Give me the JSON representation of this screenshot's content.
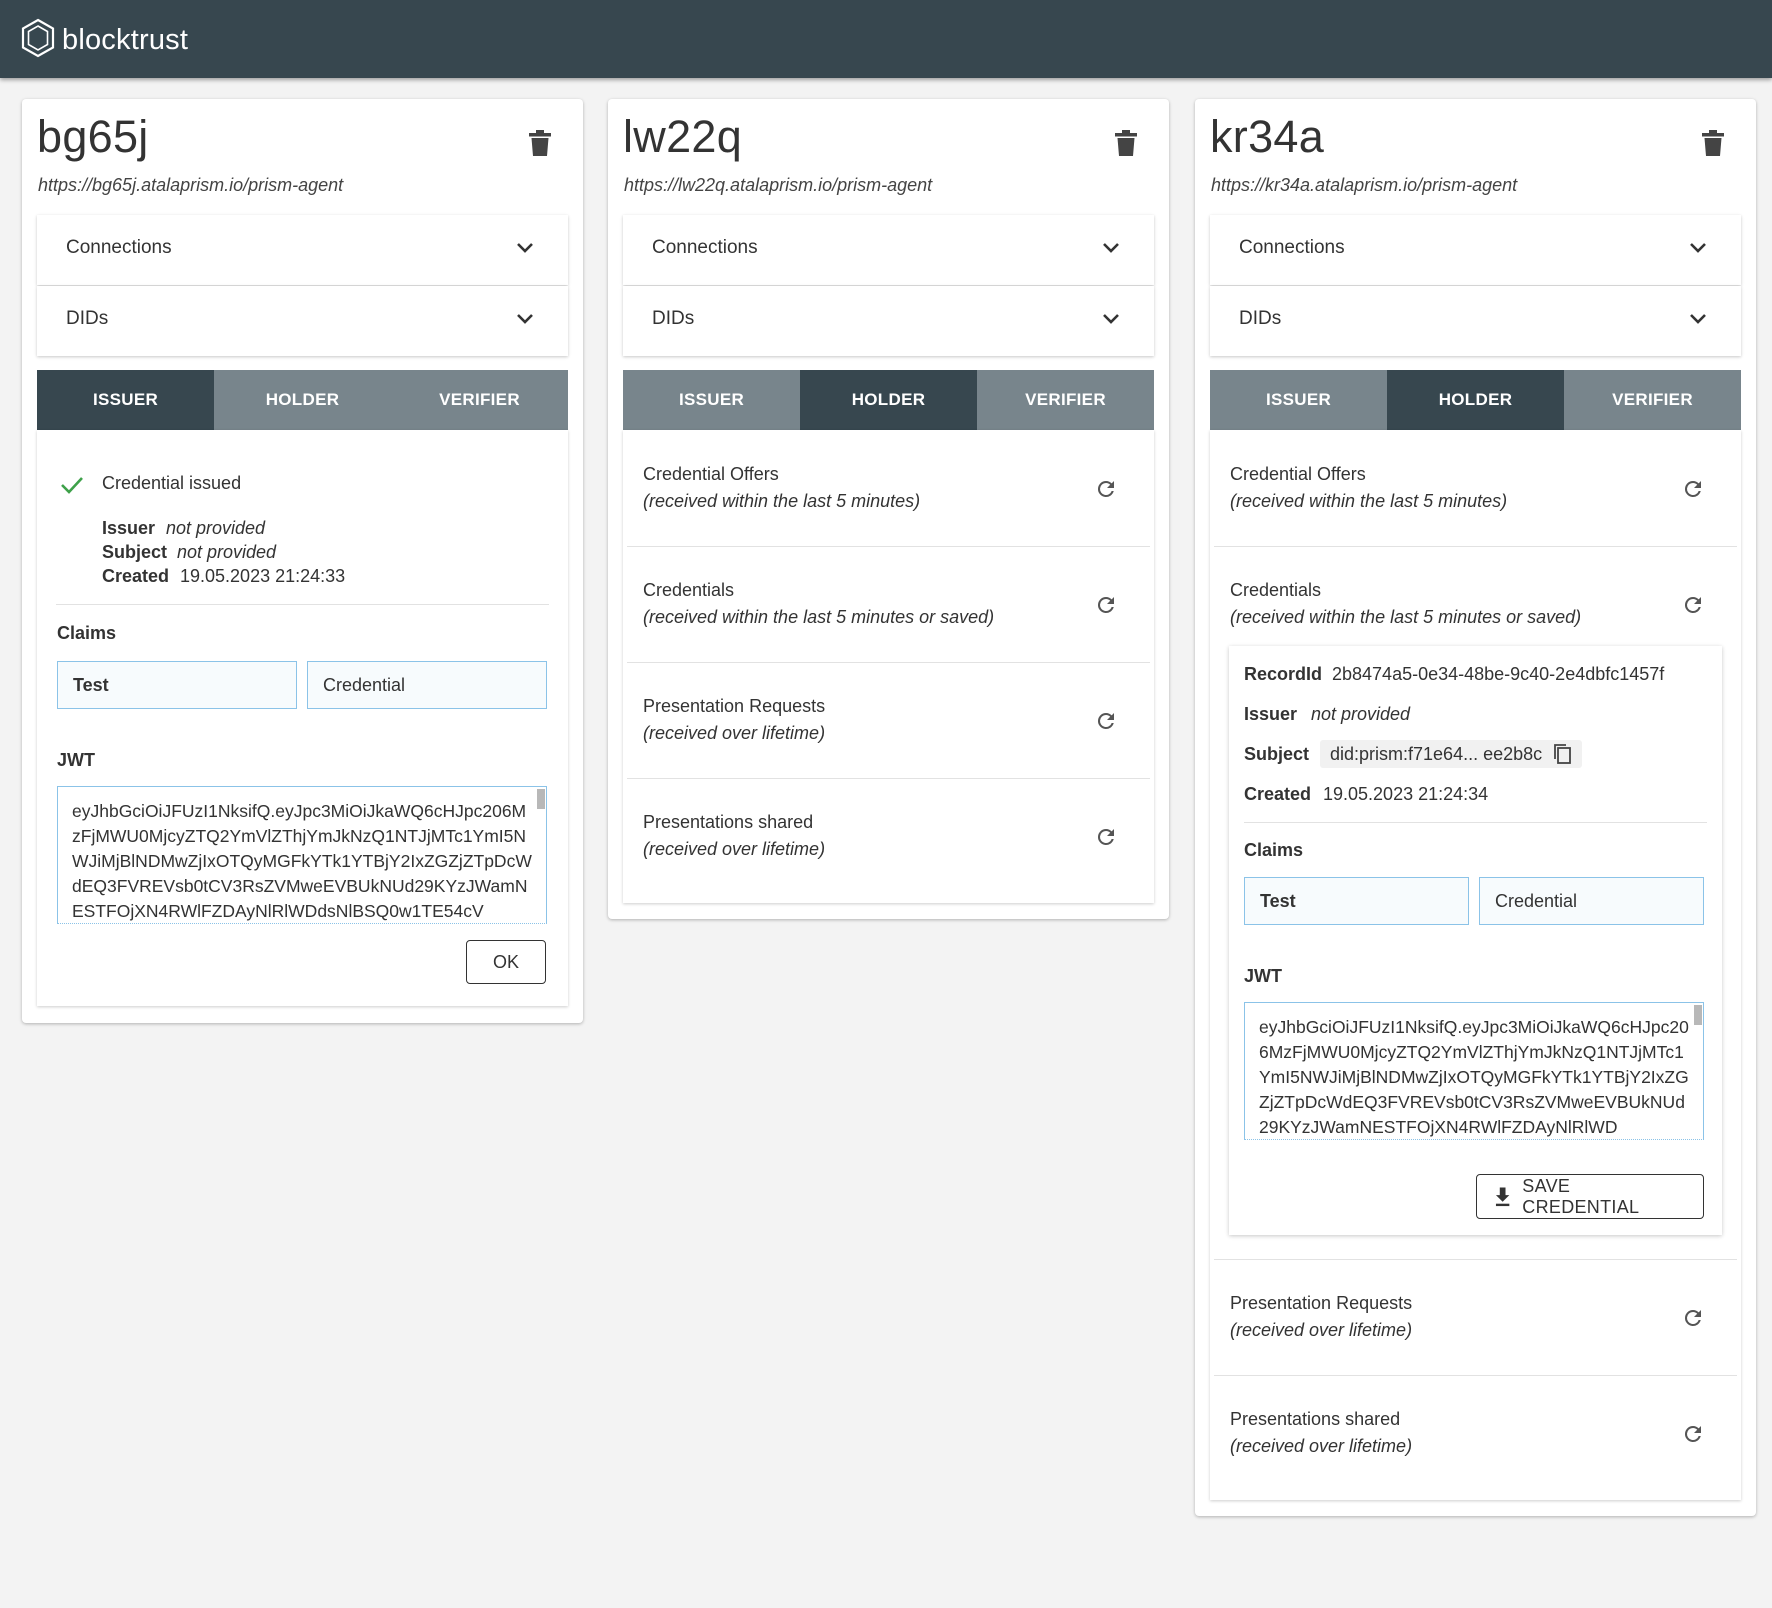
{
  "header": {
    "brand": "blocktrust"
  },
  "agents": [
    {
      "name": "bg65j",
      "url": "https://bg65j.atalaprism.io/prism-agent",
      "connections_label": "Connections",
      "dids_label": "DIDs",
      "tabs": [
        "ISSUER",
        "HOLDER",
        "VERIFIER"
      ],
      "active_tab": "ISSUER",
      "issuer_panel": {
        "status": "Credential issued",
        "issuer_key": "Issuer",
        "issuer_value": "not provided",
        "subject_key": "Subject",
        "subject_value": "not provided",
        "created_key": "Created",
        "created_value": "19.05.2023 21:24:33",
        "claims_label": "Claims",
        "claim_key": "Test",
        "claim_value": "Credential",
        "jwt_label": "JWT",
        "jwt": "eyJhbGciOiJFUzI1NksifQ.eyJpc3MiOiJkaWQ6cHJpc206MzFjMWU0MjcyZTQ2YmVlZThjYmJkNzQ1NTJjMTc1YmI5NWJiMjBlNDMwZjIxOTQyMGFkYTk1YTBjY2IxZGZjZTpDcWdEQ3FVREVsb0tCV3RsZVMweEVBUkNUd29KYzJWamNESTFOjXN4RWlFZDAyNlRlWDdsNlBSQ0w1TE54cV",
        "ok_label": "OK"
      }
    },
    {
      "name": "lw22q",
      "url": "https://lw22q.atalaprism.io/prism-agent",
      "connections_label": "Connections",
      "dids_label": "DIDs",
      "tabs": [
        "ISSUER",
        "HOLDER",
        "VERIFIER"
      ],
      "active_tab": "HOLDER",
      "holder_panel": {
        "sections": [
          {
            "title": "Credential Offers",
            "subtitle": "(received within the last 5 minutes)"
          },
          {
            "title": "Credentials",
            "subtitle": "(received within the last 5 minutes or saved)"
          },
          {
            "title": "Presentation Requests",
            "subtitle": "(received over lifetime)"
          },
          {
            "title": "Presentations shared",
            "subtitle": "(received over lifetime)"
          }
        ]
      }
    },
    {
      "name": "kr34a",
      "url": "https://kr34a.atalaprism.io/prism-agent",
      "connections_label": "Connections",
      "dids_label": "DIDs",
      "tabs": [
        "ISSUER",
        "HOLDER",
        "VERIFIER"
      ],
      "active_tab": "HOLDER",
      "holder_panel": {
        "sections": [
          {
            "title": "Credential Offers",
            "subtitle": "(received within the last 5 minutes)"
          },
          {
            "title": "Credentials",
            "subtitle": "(received within the last 5 minutes or saved)"
          },
          {
            "title": "Presentation Requests",
            "subtitle": "(received over lifetime)"
          },
          {
            "title": "Presentations shared",
            "subtitle": "(received over lifetime)"
          }
        ],
        "credential": {
          "record_key": "RecordId",
          "record_value": "2b8474a5-0e34-48be-9c40-2e4dbfc1457f",
          "issuer_key": "Issuer",
          "issuer_value": "not provided",
          "subject_key": "Subject",
          "subject_value": "did:prism:f71e64... ee2b8c",
          "created_key": "Created",
          "created_value": "19.05.2023 21:24:34",
          "claims_label": "Claims",
          "claim_key": "Test",
          "claim_value": "Credential",
          "jwt_label": "JWT",
          "jwt": "eyJhbGciOiJFUzI1NksifQ.eyJpc3MiOiJkaWQ6cHJpc206MzFjMWU0MjcyZTQ2YmVlZThjYmJkNzQ1NTJjMTc1YmI5NWJiMjBlNDMwZjIxOTQyMGFkYTk1YTBjY2IxZGZjZTpDcWdEQ3FVREVsb0tCV3RsZVMweEVBUkNUd29KYzJWamNESTFOjXN4RWlFZDAyNlRlWD",
          "save_label": "SAVE CREDENTIAL"
        }
      }
    }
  ]
}
